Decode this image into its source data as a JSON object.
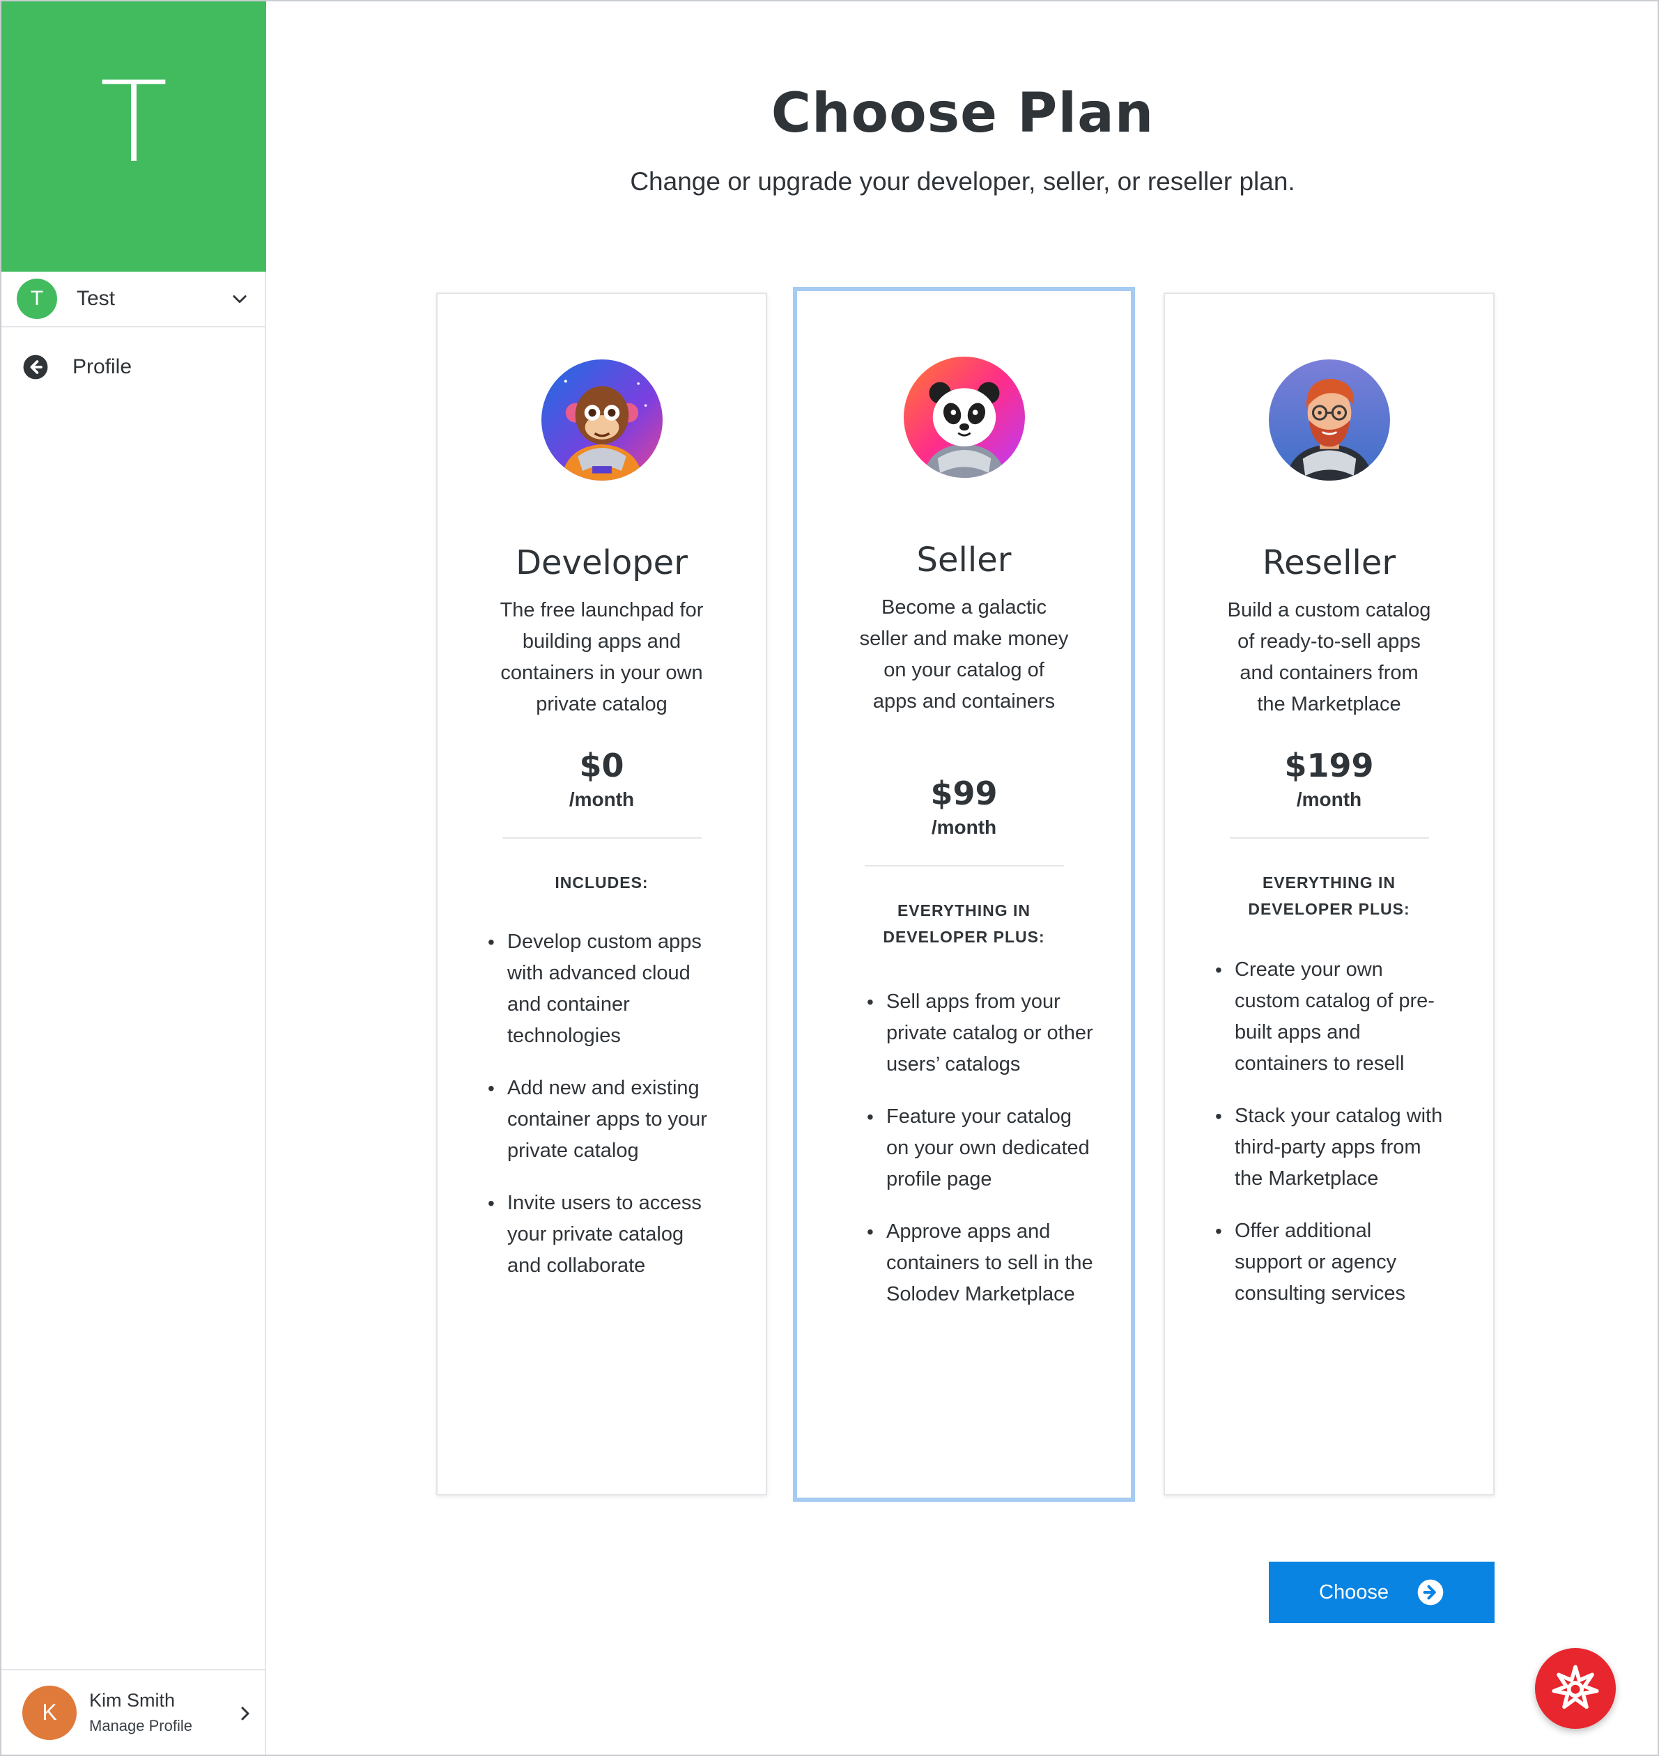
{
  "sidebar": {
    "hero_letter": "T",
    "workspace": {
      "avatar_letter": "T",
      "name": "Test"
    },
    "nav": [
      {
        "label": "Profile",
        "icon": "arrow-left-circle-icon"
      }
    ],
    "user": {
      "avatar_letter": "K",
      "name": "Kim Smith",
      "subtitle": "Manage Profile"
    }
  },
  "header": {
    "title": "Choose Plan",
    "subtitle": "Change or upgrade your developer, seller, or reseller plan."
  },
  "plans": [
    {
      "name": "Developer",
      "avatar": "astronaut-monkey",
      "description": "The free launchpad for building apps and containers in your own private catalog",
      "price": "$0",
      "period": "/month",
      "includes_label": "INCLUDES:",
      "features": [
        "Develop custom apps with advanced cloud and container technologies",
        "Add new and existing container apps to your private catalog",
        "Invite users to access your private catalog and collaborate"
      ]
    },
    {
      "name": "Seller",
      "avatar": "astronaut-panda",
      "selected": true,
      "description": "Become a galactic seller and make money on your catalog of apps and containers",
      "price": "$99",
      "period": "/month",
      "includes_label": "EVERYTHING IN DEVELOPER PLUS:",
      "features": [
        "Sell apps from your private catalog or other users’ catalogs",
        "Feature your catalog on your own dedicated profile page",
        "Approve apps and containers to sell in the Solodev Marketplace"
      ]
    },
    {
      "name": "Reseller",
      "avatar": "astronaut-bearded-man",
      "description": "Build a custom catalog of ready-to-sell apps and containers from the Marketplace",
      "price": "$199",
      "period": "/month",
      "includes_label": "EVERYTHING IN DEVELOPER PLUS:",
      "features": [
        "Create your own custom catalog of pre-built apps and containers to resell",
        "Stack your catalog with third-party apps from the Marketplace",
        "Offer additional support or agency consulting services"
      ]
    }
  ],
  "actions": {
    "choose_label": "Choose",
    "choose_icon": "arrow-right-circle-icon"
  },
  "help_fab": {
    "icon": "starburst-logo-icon"
  },
  "colors": {
    "brand_green": "#42bb5f",
    "primary_blue": "#0a84e3",
    "selected_border": "#a5cbf2",
    "fab_red": "#e8262d",
    "user_avatar": "#e07a3a"
  }
}
